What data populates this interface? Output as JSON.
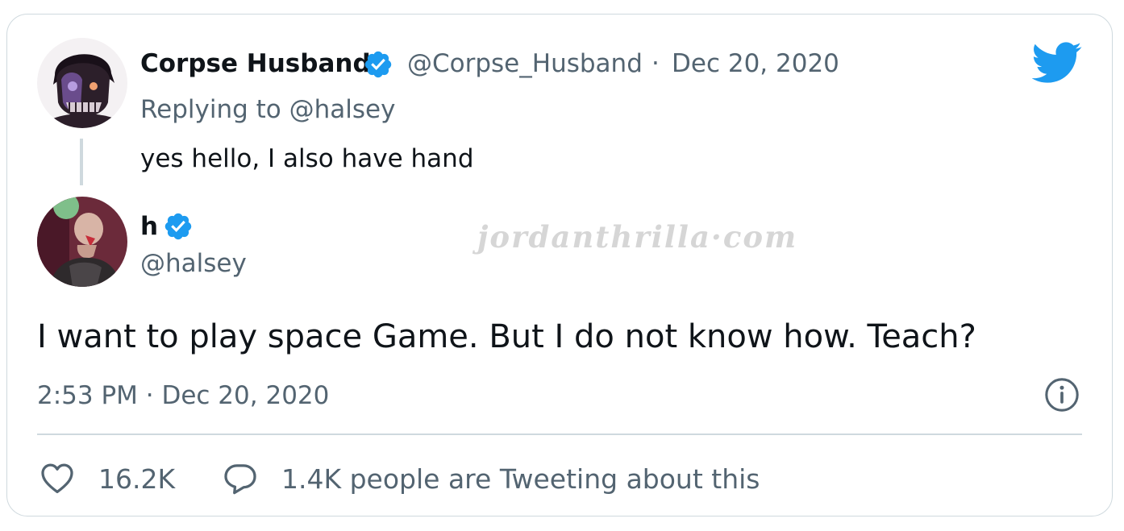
{
  "reply_tweet": {
    "display_name": "Corpse Husband",
    "handle": "@Corpse_Husband",
    "separator": "·",
    "date": "Dec 20, 2020",
    "replying_to": "Replying to @halsey",
    "text": "yes hello, I also have hand"
  },
  "main_tweet": {
    "display_name": "h",
    "handle": "@halsey",
    "text": "I want to play space Game. But I do not know how. Teach?",
    "timestamp": "2:53 PM · Dec 20, 2020"
  },
  "watermark": "jordanthrilla·com",
  "actions": {
    "likes": "16.2K",
    "tweeting": "1.4K people are Tweeting about this"
  },
  "colors": {
    "brand_blue": "#1d9bf0",
    "text_primary": "#0f1419",
    "text_secondary": "#536471",
    "border": "#cfd9de"
  },
  "icons": [
    "twitter-bird-icon",
    "verified-badge-icon",
    "info-icon",
    "heart-icon",
    "reply-bubble-icon"
  ]
}
